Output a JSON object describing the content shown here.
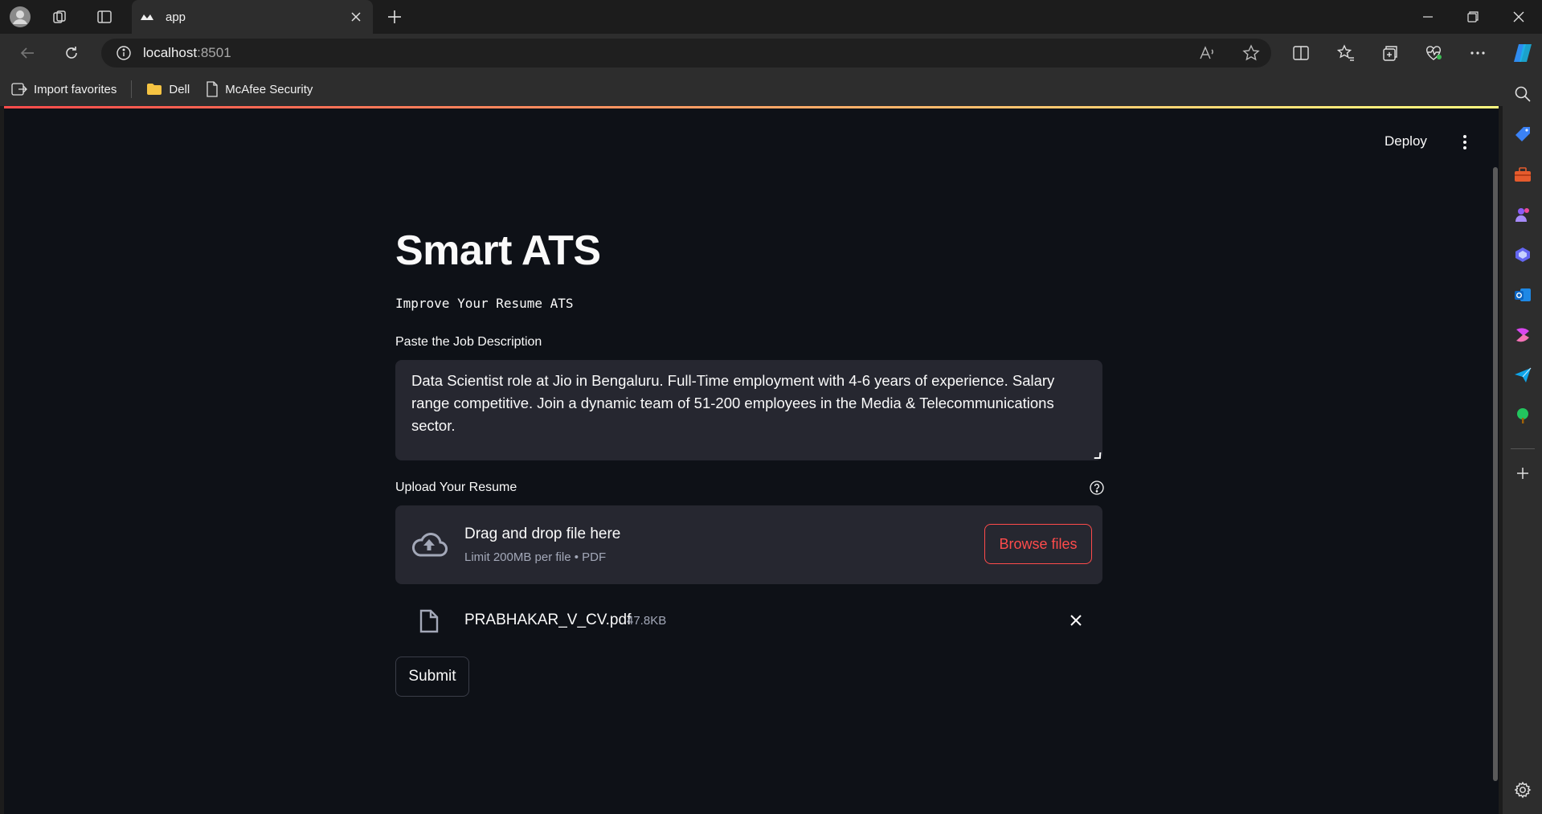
{
  "browser": {
    "tab_title": "app",
    "url_host": "localhost",
    "url_port": ":8501",
    "bookmarks": [
      {
        "label": "Import favorites",
        "icon": "import-icon"
      },
      {
        "label": "Dell",
        "icon": "folder-icon"
      },
      {
        "label": "McAfee Security",
        "icon": "page-icon"
      }
    ]
  },
  "app": {
    "deploy_label": "Deploy",
    "title": "Smart ATS",
    "subtitle": "Improve Your Resume ATS",
    "jd_label": "Paste the Job Description",
    "jd_text": "Data Scientist role at Jio in Bengaluru. Full-Time employment with 4-6 years of experience. Salary range competitive. Join a dynamic team of 51-200 employees in the Media & Telecommunications sector.",
    "upload_label": "Upload Your Resume",
    "dropzone_title": "Drag and drop file here",
    "dropzone_sub": "Limit 200MB per file • PDF",
    "browse_label": "Browse files",
    "uploaded_file": {
      "name": "PRABHAKAR_V_CV.pdf",
      "size": "47.8KB"
    },
    "submit_label": "Submit"
  },
  "colors": {
    "accent": "#ff4b4b",
    "page_bg": "#0e1117",
    "widget_bg": "#262730"
  }
}
